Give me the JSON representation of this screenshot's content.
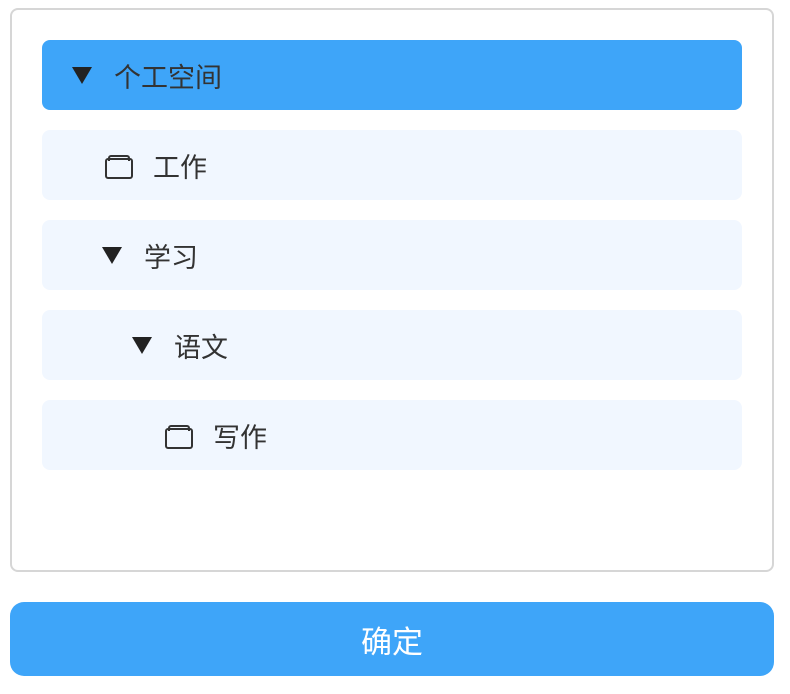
{
  "tree": {
    "nodes": [
      {
        "label": "个工空间",
        "icon": "caret-down-icon",
        "depth": 0,
        "expanded": true,
        "selected": true
      },
      {
        "label": "工作",
        "icon": "folder-icon",
        "depth": 1,
        "expanded": false,
        "selected": false
      },
      {
        "label": "学习",
        "icon": "caret-down-icon",
        "depth": 1,
        "expanded": true,
        "selected": false
      },
      {
        "label": "语文",
        "icon": "caret-down-icon",
        "depth": 2,
        "expanded": true,
        "selected": false
      },
      {
        "label": "写作",
        "icon": "folder-icon",
        "depth": 3,
        "expanded": false,
        "selected": false
      }
    ]
  },
  "footer": {
    "confirm_label": "确定"
  },
  "colors": {
    "accent": "#3ea5f9",
    "row_bg": "#f1f7ff",
    "text": "#333333",
    "border": "#d6d6d6"
  }
}
